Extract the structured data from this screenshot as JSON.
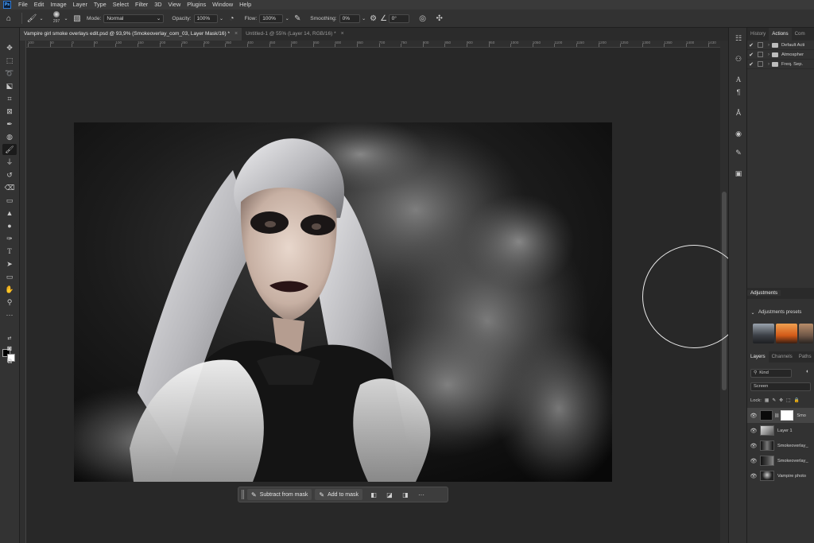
{
  "app": {
    "logo_text": "Ps",
    "menu": [
      "File",
      "Edit",
      "Image",
      "Layer",
      "Type",
      "Select",
      "Filter",
      "3D",
      "View",
      "Plugins",
      "Window",
      "Help"
    ]
  },
  "options": {
    "brush_size": "297",
    "mode_label": "Mode:",
    "mode_value": "Normal",
    "opacity_label": "Opacity:",
    "opacity_value": "100%",
    "flow_label": "Flow:",
    "flow_value": "100%",
    "smoothing_label": "Smoothing:",
    "smoothing_value": "0%",
    "angle_value": "0°"
  },
  "tabs": [
    {
      "label": "Vampire girl smoke overlays edit.psd @ 93,9% (Smokeoverlay_com_03, Layer Mask/16) *",
      "close": "×"
    },
    {
      "label": "Untitled-1 @ 55% (Layer 14, RGB/16) *",
      "close": "×"
    }
  ],
  "ruler": [
    "100",
    "50",
    "0",
    "50",
    "100",
    "150",
    "200",
    "250",
    "300",
    "350",
    "400",
    "450",
    "500",
    "550",
    "600",
    "650",
    "700",
    "750",
    "800",
    "850",
    "900",
    "950",
    "1000",
    "1050",
    "1100",
    "1150",
    "1200",
    "1250",
    "1300",
    "1350",
    "1400",
    "1430"
  ],
  "taskbar": {
    "subtract_label": "Subtract from mask",
    "add_label": "Add to mask",
    "more": "···"
  },
  "right_panel": {
    "top_tabs": [
      "History",
      "Actions",
      "Com"
    ],
    "actions": [
      "Default Acti",
      "Atmospher",
      "Freq. Sep."
    ],
    "adjustments_tab": "Adjustments",
    "adjustments_presets": "Adjustments presets",
    "layers_tabs": [
      "Layers",
      "Channels",
      "Paths"
    ],
    "kind_label": "Kind",
    "blend_mode": "Screen",
    "lock_label": "Lock:",
    "layers": [
      "Smo",
      "Layer 1",
      "Smokeoverlay_",
      "Smokeoverlay_",
      "Vampire photo"
    ]
  },
  "colors": {
    "accent": "#2f7bd8",
    "canvas_bg": "#282828",
    "panel_bg": "#323232"
  }
}
